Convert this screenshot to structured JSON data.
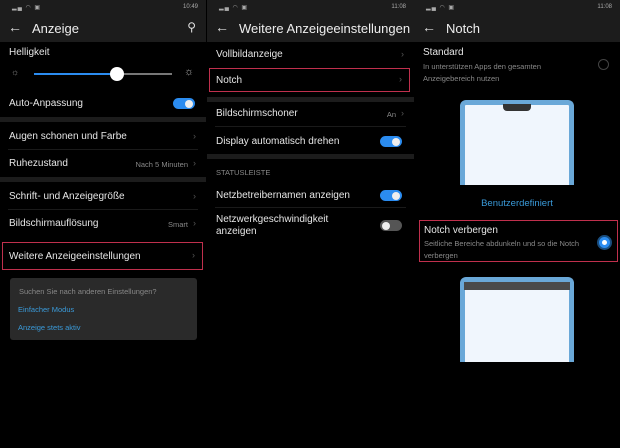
{
  "panel1": {
    "status_time": "10:49",
    "title": "Anzeige",
    "brightness_label": "Helligkeit",
    "brightness_value": 0.6,
    "auto_label": "Auto-Anpassung",
    "auto_on": true,
    "items": [
      {
        "label": "Augen schonen und Farbe",
        "value": ""
      },
      {
        "label": "Ruhezustand",
        "value": "Nach 5 Minuten"
      },
      {
        "label": "Schrift- und Anzeigegröße",
        "value": ""
      },
      {
        "label": "Bildschirmauflösung",
        "value": "Smart"
      },
      {
        "label": "Weitere Anzeigeeinstellungen",
        "value": ""
      }
    ],
    "suggest": {
      "question": "Suchen Sie nach anderen Einstellungen?",
      "links": [
        "Einfacher Modus",
        "Anzeige stets aktiv"
      ]
    }
  },
  "panel2": {
    "status_time": "11:08",
    "title": "Weitere Anzeigeeinstellungen",
    "items": [
      {
        "label": "Vollbildanzeige"
      },
      {
        "label": "Notch"
      },
      {
        "label": "Bildschirmschoner",
        "value": "An"
      },
      {
        "label": "Display automatisch drehen",
        "on": true
      }
    ],
    "section": "STATUSLEISTE",
    "status_items": [
      {
        "label": "Netzbetreibernamen anzeigen",
        "on": true
      },
      {
        "label": "Netzwerkgeschwindigkeit anzeigen",
        "on": false
      }
    ]
  },
  "panel3": {
    "status_time": "11:08",
    "title": "Notch",
    "standard": {
      "title": "Standard",
      "desc": "In unterstützen Apps den gesamten Anzeigebereich nutzen",
      "selected": false
    },
    "custom_link": "Benutzerdefiniert",
    "hide": {
      "title": "Notch verbergen",
      "desc": "Seitliche Bereiche abdunkeln und so die Notch verbergen",
      "selected": true
    }
  },
  "colors": {
    "accent": "#2b8cf0",
    "highlight": "#c0304d",
    "link": "#3a9ad9"
  }
}
